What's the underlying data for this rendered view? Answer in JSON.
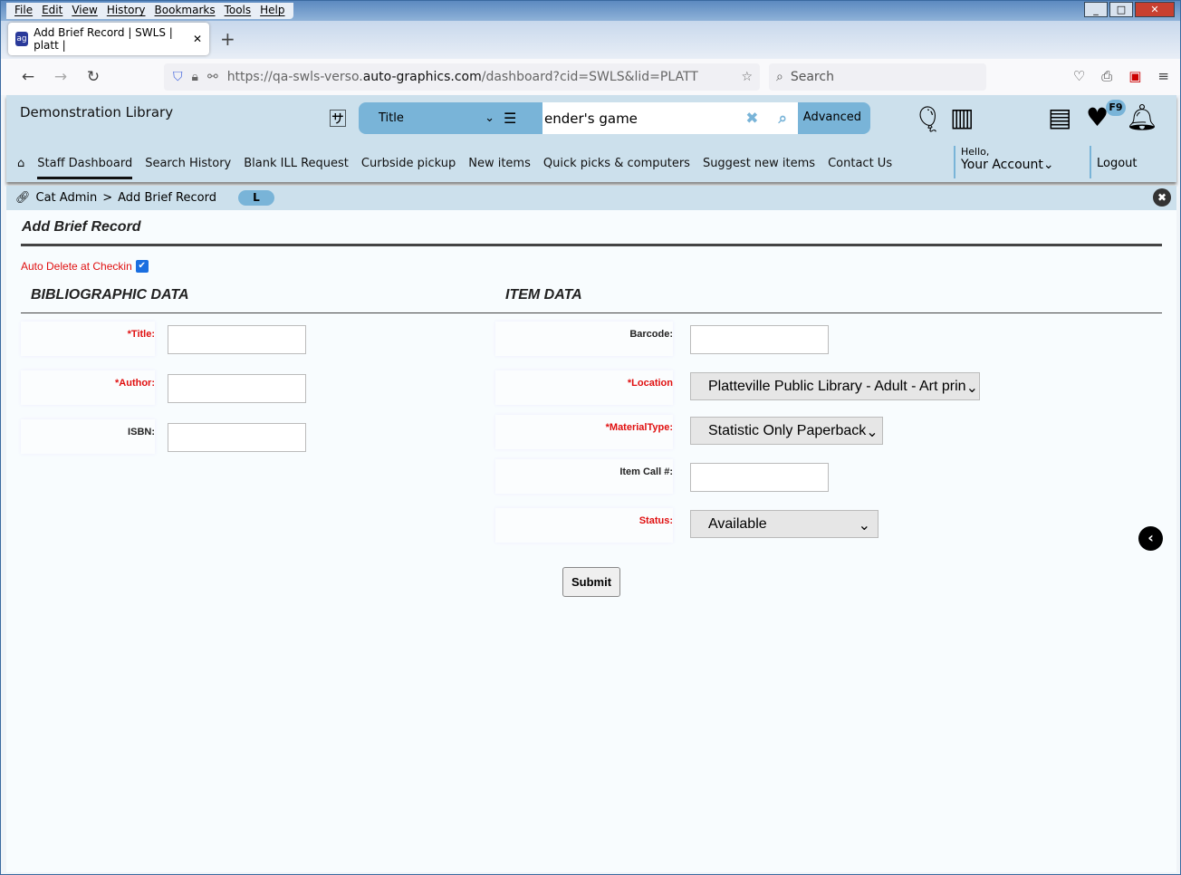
{
  "browser": {
    "menu": [
      "File",
      "Edit",
      "View",
      "History",
      "Bookmarks",
      "Tools",
      "Help"
    ],
    "tab_title": "Add Brief Record | SWLS | platt |",
    "url_prefix": "https://qa-swls-verso.",
    "url_domain": "auto-graphics.com",
    "url_path": "/dashboard?cid=SWLS&lid=PLATT",
    "search_placeholder": "Search"
  },
  "header": {
    "library": "Demonstration Library",
    "search_type": "Title",
    "search_value": "ender's game",
    "advanced": "Advanced",
    "badge": "F9",
    "hello": "Hello,",
    "account": "Your Account",
    "logout": "Logout"
  },
  "nav": [
    "Staff Dashboard",
    "Search History",
    "Blank ILL Request",
    "Curbside pickup",
    "New items",
    "Quick picks & computers",
    "Suggest new items",
    "Contact Us"
  ],
  "breadcrumb": {
    "parent": "Cat Admin",
    "sep": ">",
    "current": "Add Brief Record",
    "pill": "L"
  },
  "form": {
    "title": "Add Brief Record",
    "auto_delete": "Auto Delete at Checkin",
    "auto_delete_checked": true,
    "bib_heading": "BIBLIOGRAPHIC DATA",
    "item_heading": "ITEM DATA",
    "title_label": "*Title:",
    "author_label": "*Author:",
    "isbn_label": "ISBN:",
    "barcode_label": "Barcode:",
    "location_label": "*Location",
    "location_value": "Platteville Public Library - Adult - Art prin",
    "material_label": "*MaterialType:",
    "material_value": "Statistic Only Paperback",
    "callno_label": "Item Call #:",
    "status_label": "Status:",
    "status_value": "Available",
    "submit": "Submit"
  },
  "colors": {
    "header_bg": "#cce0ec",
    "accent": "#79b4d8",
    "required": "#e01010"
  }
}
